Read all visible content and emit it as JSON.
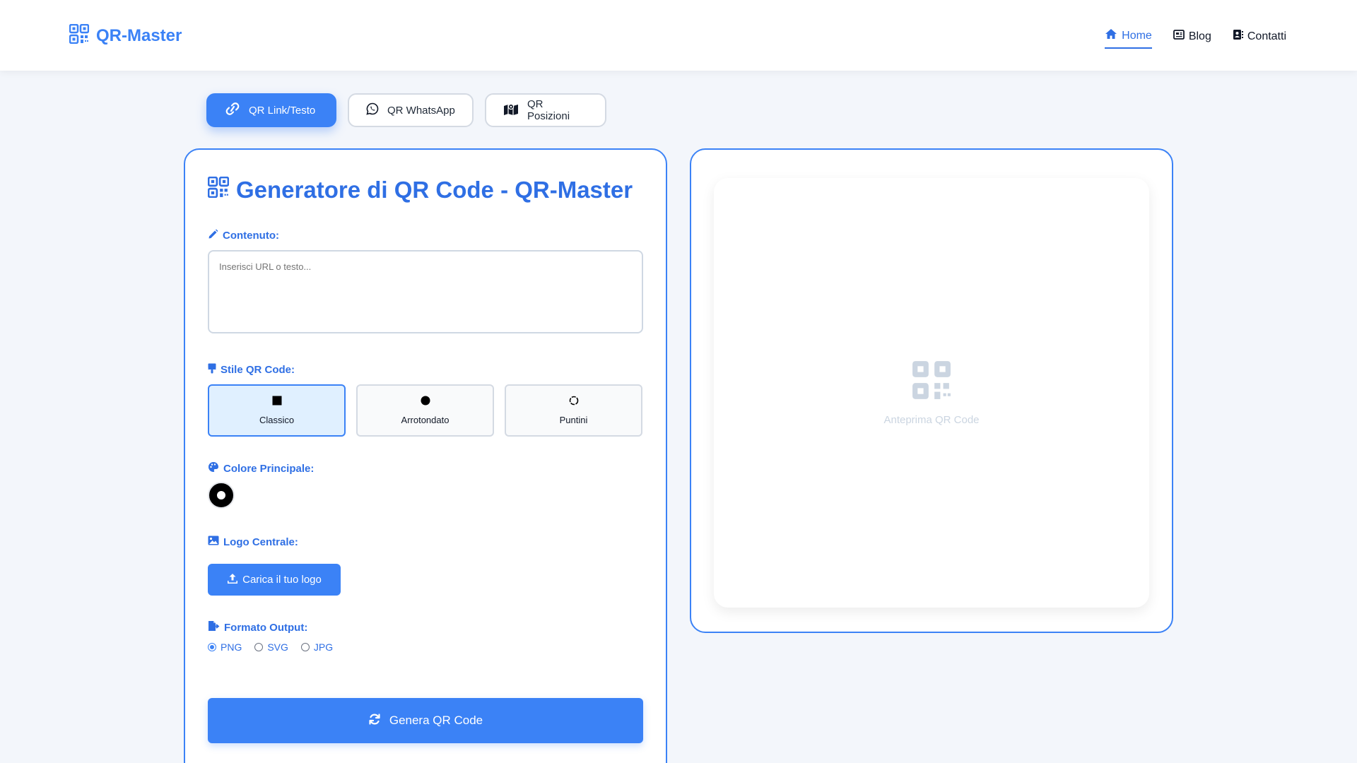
{
  "header": {
    "brand": "QR-Master",
    "nav": [
      {
        "label": "Home",
        "icon": "home-icon",
        "active": true
      },
      {
        "label": "Blog",
        "icon": "newspaper-icon",
        "active": false
      },
      {
        "label": "Contatti",
        "icon": "contact-card-icon",
        "active": false
      }
    ]
  },
  "tabs": [
    {
      "label": "QR Link/Testo",
      "icon": "link-icon",
      "active": true
    },
    {
      "label": "QR WhatsApp",
      "icon": "whatsapp-icon",
      "active": false
    },
    {
      "label": "QR Posizioni",
      "icon": "map-icon",
      "active": false
    }
  ],
  "generator": {
    "title": "Generatore di QR Code - QR-Master",
    "content_label": "Contenuto:",
    "content_placeholder": "Inserisci URL o testo...",
    "style_label": "Stile QR Code:",
    "styles": [
      {
        "label": "Classico",
        "selected": true
      },
      {
        "label": "Arrotondato",
        "selected": false
      },
      {
        "label": "Puntini",
        "selected": false
      }
    ],
    "color_label": "Colore Principale:",
    "color_value": "#000000",
    "logo_label": "Logo Centrale:",
    "logo_button": "Carica il tuo logo",
    "format_label": "Formato Output:",
    "formats": [
      {
        "label": "PNG",
        "checked": true
      },
      {
        "label": "SVG",
        "checked": false
      },
      {
        "label": "JPG",
        "checked": false
      }
    ],
    "generate_button": "Genera QR Code"
  },
  "preview": {
    "placeholder": "Anteprima QR Code"
  },
  "colors": {
    "accent": "#3b82f6",
    "accent_text": "#2f6fe4",
    "placeholder_icon": "#cbd5e1"
  }
}
